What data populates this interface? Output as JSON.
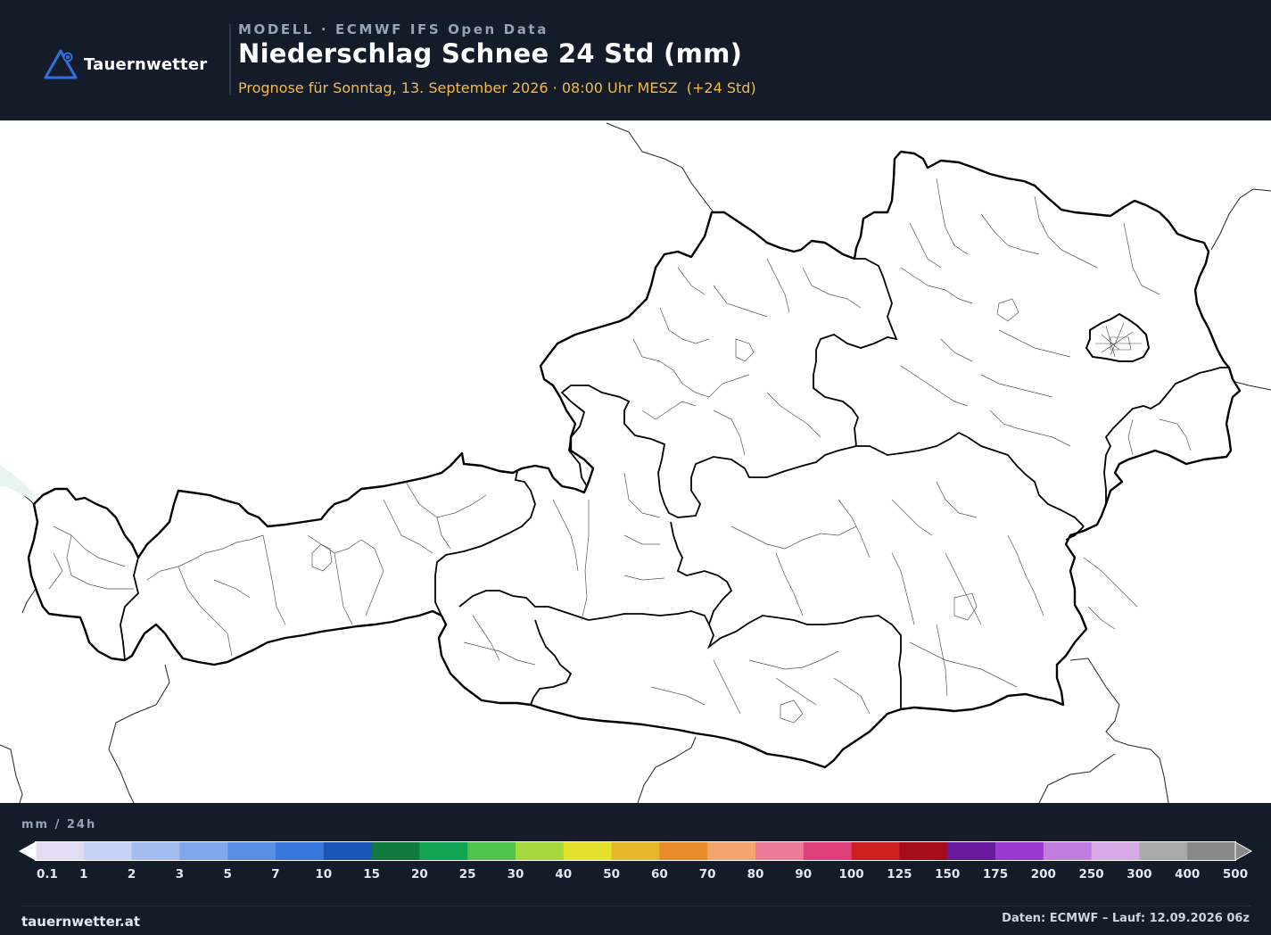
{
  "header": {
    "logo_text": "Tauernwetter",
    "model_line": "MODELL · ECMWF IFS Open Data",
    "title": "Niederschlag Schnee 24 Std (mm)",
    "subtitle": "Prognose für Sonntag, 13. September 2026 · 08:00 Uhr MESZ  (+24 Std)"
  },
  "legend": {
    "unit": "mm / 24h",
    "ticks": [
      "0.1",
      "1",
      "2",
      "3",
      "5",
      "7",
      "10",
      "15",
      "20",
      "25",
      "30",
      "40",
      "50",
      "60",
      "70",
      "80",
      "90",
      "100",
      "125",
      "150",
      "175",
      "200",
      "250",
      "300",
      "400",
      "500"
    ],
    "colors": [
      "#e4dcf3",
      "#c6d3f6",
      "#a3bdf1",
      "#80a7ec",
      "#5a8fe6",
      "#3877db",
      "#1b55b6",
      "#0f7a3b",
      "#12a553",
      "#4ec44e",
      "#a4d93b",
      "#e4e12c",
      "#e6b62a",
      "#e88c2b",
      "#f2a46e",
      "#ec7b98",
      "#de3f7a",
      "#cf2020",
      "#a50d1a",
      "#6a1a9c",
      "#9b3ad0",
      "#c17edf",
      "#d6a9e6",
      "#aaaaaa",
      "#888888"
    ]
  },
  "footer": {
    "site": "tauernwetter.at",
    "credit": "Daten: ECMWF – Lauf: 12.09.2026 06z"
  },
  "colors": {
    "background": "#141c29",
    "accent_orange": "#f5b94a",
    "logo_blue": "#2f6fe0"
  }
}
